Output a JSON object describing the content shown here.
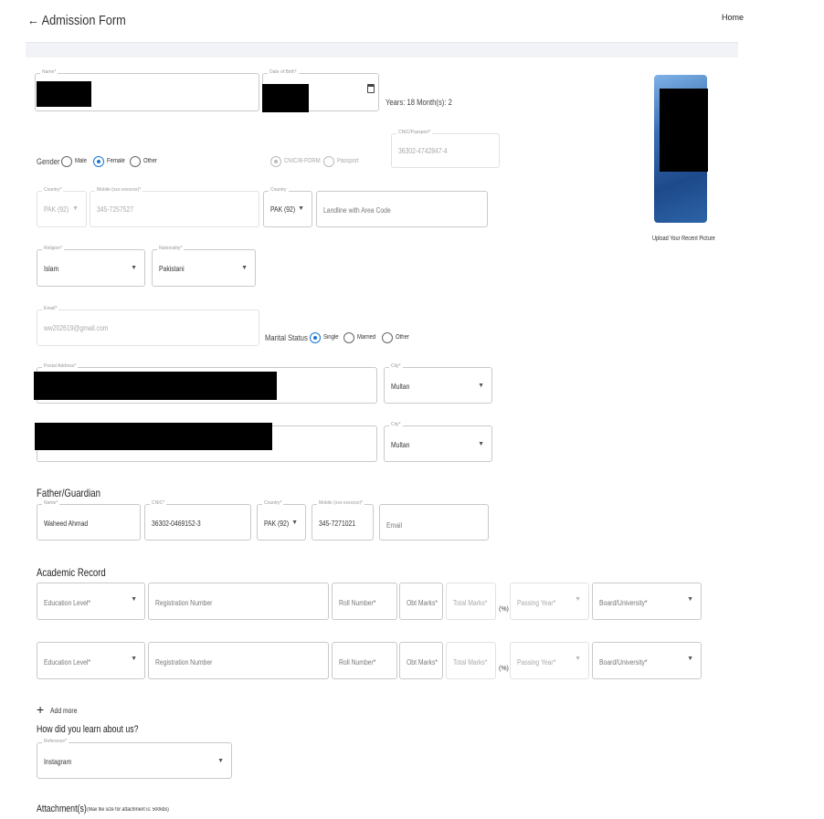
{
  "header": {
    "back_icon": "arrow-left-icon",
    "title": "Admission Form",
    "home_link": "Home"
  },
  "personal": {
    "name_label": "Name*",
    "dob_label": "Date of Birth*",
    "calendar_icon": "calendar-icon",
    "age_text": "Years: 18 Month(s): 2",
    "cnic_label": "CNIC/Passport*",
    "cnic_value": "36302-4742847-4",
    "gender": {
      "label": "Gender",
      "options": [
        "Male",
        "Female",
        "Other"
      ],
      "selected": "Female"
    },
    "id_type": {
      "options": [
        "CNIC/B-FORM",
        "Passport"
      ],
      "selected": "CNIC/B-FORM"
    },
    "mobile": {
      "country_label": "Country*",
      "country_value": "PAK (92)",
      "number_label": "Mobile (xxx-xxxxxxx)*",
      "number_value": "345-7257527"
    },
    "landline": {
      "country_label": "Country",
      "country_value": "PAK (92)",
      "placeholder": "Landline with Area Code"
    },
    "religion": {
      "label": "Religion*",
      "value": "Islam"
    },
    "nationality": {
      "label": "Nationality*",
      "value": "Pakistani"
    },
    "email": {
      "label": "Email*",
      "value": "ww202619@gmail.com"
    },
    "marital": {
      "label": "Marital Status",
      "options": [
        "Single",
        "Married",
        "Other"
      ],
      "selected": "Single"
    },
    "postal": {
      "label": "Postal Address*",
      "city_label": "City*",
      "city_value": "Multan"
    },
    "permanent": {
      "city_label": "City*",
      "city_value": "Multan"
    }
  },
  "photo": {
    "upload_label": "Upload Your Recent Picture"
  },
  "guardian": {
    "section_title": "Father/Guardian",
    "name_label": "Name*",
    "name_value": "Waheed Ahmad",
    "cnic_label": "CNIC*",
    "cnic_value": "36302-0469152-3",
    "country_label": "Country*",
    "country_value": "PAK (92)",
    "mobile_label": "Mobile (xxx-xxxxxxx)*",
    "mobile_value": "345-7271021",
    "email_placeholder": "Email"
  },
  "academic": {
    "section_title": "Academic Record",
    "rows": [
      {
        "education_level": "Education Level*",
        "registration": "Registration Number",
        "roll": "Roll Number*",
        "obt": "Obt Marks*",
        "total": "Total Marks*",
        "pct": "(%)",
        "passing_year": "Passing Year*",
        "board": "Board/University*"
      },
      {
        "education_level": "Education Level*",
        "registration": "Registration Number",
        "roll": "Roll Number*",
        "obt": "Obt Marks*",
        "total": "Total Marks*",
        "pct": "(%)",
        "passing_year": "Passing Year*",
        "board": "Board/University*"
      }
    ],
    "add_more": "Add more"
  },
  "reference": {
    "question": "How did you learn about us?",
    "label": "Reference*",
    "value": "Instagram"
  },
  "attachments": {
    "title": "Attachment(s)",
    "note": "(Max file size for attachment is: 500kbs)"
  }
}
